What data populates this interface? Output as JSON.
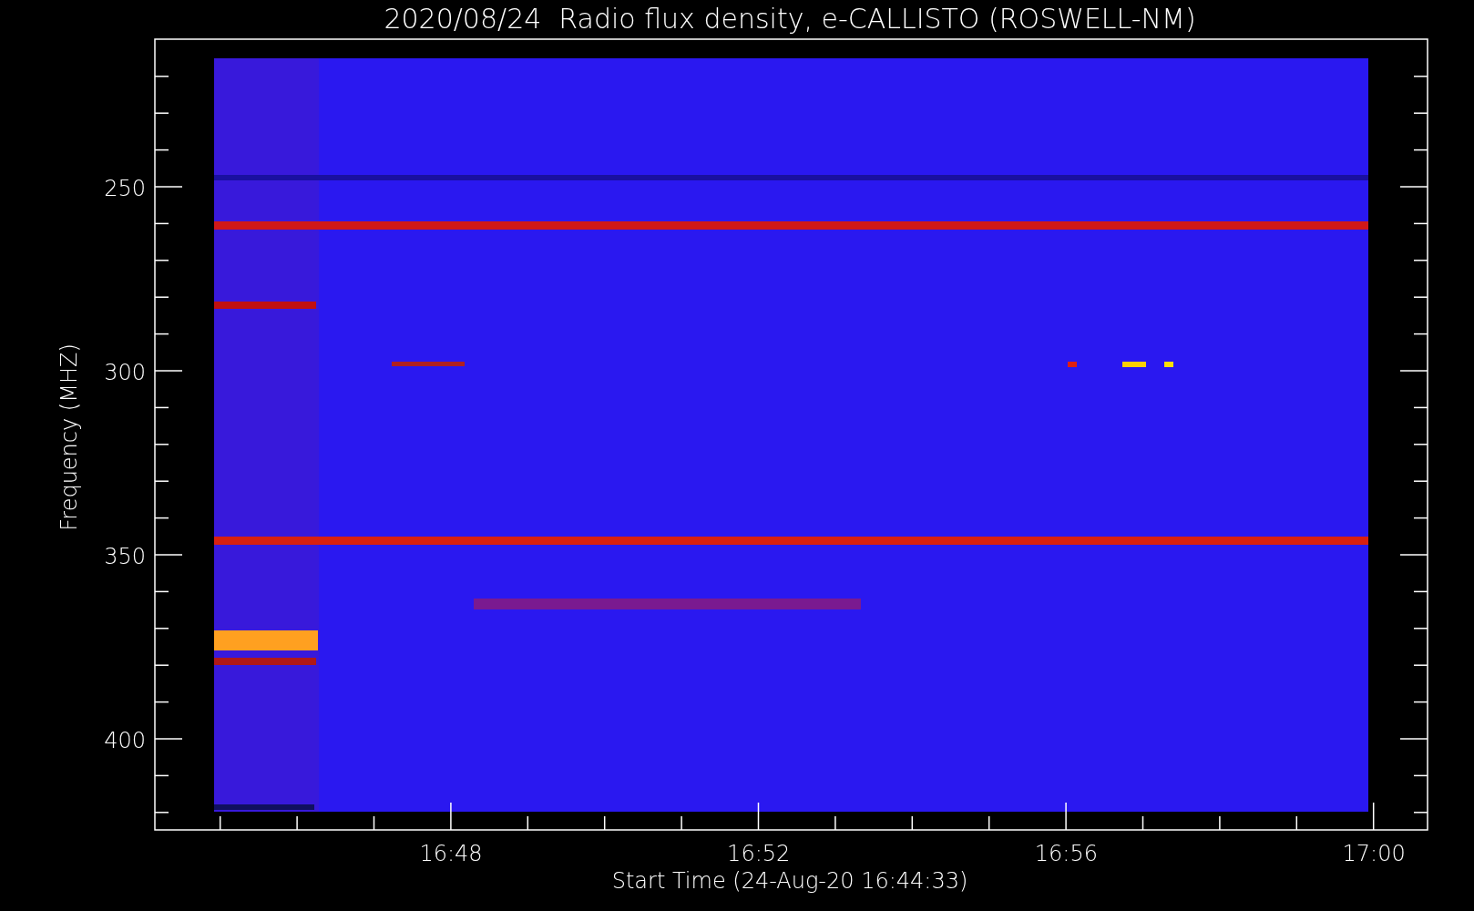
{
  "title": "2020/08/24  Radio flux density, e-CALLISTO (ROSWELL-NM)",
  "y_axis": {
    "label": "Frequency (MHZ)",
    "ticks": [
      "250",
      "300",
      "350",
      "400"
    ]
  },
  "x_axis": {
    "label": "Start Time (24-Aug-20 16:44:33)",
    "ticks": [
      "16:48",
      "16:52",
      "16:56",
      "17:00"
    ]
  }
}
